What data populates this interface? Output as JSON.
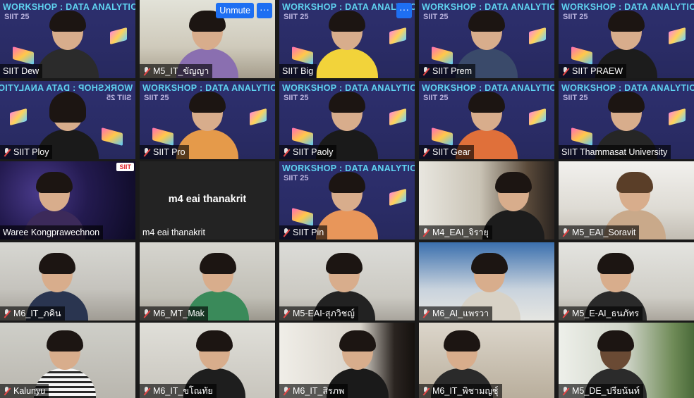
{
  "app": "Zoom gallery view",
  "workshop_banner": "WORKSHOP : DATA ANALYTICS",
  "logo_text": "SIIT 25",
  "colors": {
    "banner": "#5fd3f0",
    "workshop_bg": "#2d2f6e",
    "unmute": "#1e6ff2",
    "muted_icon": "#e64545"
  },
  "controls": {
    "unmute_label": "Unmute",
    "more_label": "···"
  },
  "corner_badge": "SIIT",
  "tiles": [
    {
      "name": "SIIT Dew",
      "muted": false
    },
    {
      "name": "M5_IT_ขัญญา",
      "muted": true
    },
    {
      "name": "SIIT Big",
      "muted": false
    },
    {
      "name": "SIIT Prem",
      "muted": true
    },
    {
      "name": "SIIT PRAEW",
      "muted": true
    },
    {
      "name": "SIIT Ploy",
      "muted": true
    },
    {
      "name": "SIIT Pro",
      "muted": true
    },
    {
      "name": "SIIT Paoly",
      "muted": true
    },
    {
      "name": "SIIT Gear",
      "muted": true
    },
    {
      "name": "SIIT Thammasat University",
      "muted": false
    },
    {
      "name": "Waree Kongprawechnon",
      "muted": false
    },
    {
      "name": "m4 eai thanakrit",
      "muted": false,
      "video_off_name": "m4 eai thanakrit"
    },
    {
      "name": "SIIT Pin",
      "muted": true
    },
    {
      "name": "M4_EAI_จิรายุ",
      "muted": true
    },
    {
      "name": "M5_EAI_Soravit",
      "muted": true
    },
    {
      "name": "M6_IT_ภคิน",
      "muted": true
    },
    {
      "name": "M6_MT_Mak",
      "muted": true
    },
    {
      "name": "M5-EAI-สุภวิชญ์",
      "muted": true
    },
    {
      "name": "M6_AI_แพรวา",
      "muted": true
    },
    {
      "name": "M5_E-AI_ธนภัทร",
      "muted": true
    },
    {
      "name": "Kalunyu",
      "muted": true
    },
    {
      "name": "M6_IT_ขโณทัย",
      "muted": true
    },
    {
      "name": "M6_IT_สิรภพ",
      "muted": true
    },
    {
      "name": "M6_IT_พิชามญชุ์",
      "muted": true
    },
    {
      "name": "M5_DE_ปรียนันท์",
      "muted": true
    }
  ]
}
